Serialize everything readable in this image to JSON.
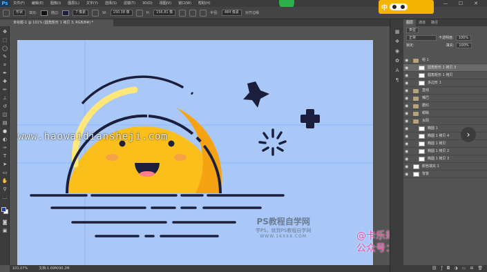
{
  "app": {
    "logo": "Ps"
  },
  "menu": [
    "文件(F)",
    "编辑(E)",
    "图像(I)",
    "图层(L)",
    "文字(Y)",
    "选择(S)",
    "滤镜(T)",
    "3D(D)",
    "视图(V)",
    "窗口(W)",
    "帮助(H)"
  ],
  "options_bar": {
    "mode": "形状",
    "fill_label": "填充:",
    "stroke_label": "描边:",
    "stroke_width": "7 像素",
    "w_label": "W:",
    "w_value": "150.38 像",
    "h_label": "H:",
    "h_value": "156.81 像",
    "radius_label": "半径:",
    "radius_value": "484 像素",
    "align_edges": "对齐边缘"
  },
  "mascot": {
    "text": "中"
  },
  "window_controls": [
    "—",
    "☐",
    "✕"
  ],
  "document_tab": {
    "title": "未标题-1 @ 101% (圆角矩形 1 拷贝 3, RGB/8#) *",
    "close": "×"
  },
  "status_bar": {
    "zoom": "101.07%",
    "doc_info": "文档:1.69M/90.2M"
  },
  "layers_panel": {
    "tabs": [
      "图层",
      "通道",
      "路径"
    ],
    "kind_filter": "类型",
    "blend_mode": "正常",
    "opacity_label": "不透明度:",
    "opacity_value": "100%",
    "lock_label": "锁定:",
    "fill_label": "填充:",
    "fill_value": "100%",
    "layers": [
      {
        "name": "组 1",
        "type": "group",
        "indent": 0,
        "selected": false
      },
      {
        "name": "圆角矩形 1 拷贝 3",
        "type": "layer",
        "indent": 1,
        "selected": true
      },
      {
        "name": "圆角矩形 1 拷贝",
        "type": "layer",
        "indent": 1,
        "selected": false
      },
      {
        "name": "多边形 1",
        "type": "layer",
        "indent": 1,
        "selected": false
      },
      {
        "name": "直线",
        "type": "group",
        "indent": 0,
        "selected": false
      },
      {
        "name": "嘴巴",
        "type": "group",
        "indent": 0,
        "selected": false
      },
      {
        "name": "腮红",
        "type": "group",
        "indent": 0,
        "selected": false
      },
      {
        "name": "眼睛",
        "type": "group",
        "indent": 0,
        "selected": false
      },
      {
        "name": "太阳",
        "type": "group",
        "indent": 0,
        "selected": false
      },
      {
        "name": "椭圆 1",
        "type": "layer",
        "indent": 1,
        "selected": false
      },
      {
        "name": "椭圆 1 拷贝 4",
        "type": "layer",
        "indent": 1,
        "selected": false
      },
      {
        "name": "椭圆 1 拷贝",
        "type": "layer",
        "indent": 1,
        "selected": false
      },
      {
        "name": "椭圆 1 拷贝 2",
        "type": "layer",
        "indent": 1,
        "selected": false
      },
      {
        "name": "椭圆 1 拷贝 3",
        "type": "layer",
        "indent": 1,
        "selected": false
      },
      {
        "name": "颜色填充 1",
        "type": "layer",
        "indent": 0,
        "selected": false
      },
      {
        "name": "背景",
        "type": "layer",
        "indent": 0,
        "selected": false
      }
    ],
    "nav_button": "›"
  },
  "watermarks": {
    "site": "www.haowaidiansheji.com",
    "ps_title": "PS教程自学网",
    "ps_subtitle": "学PS，就到PS教程自学网",
    "ps_url": "WWW.16XX8.COM",
    "author_line1": "@卡乐筠",
    "author_line2": "公众号：卡乐筠"
  },
  "colors": {
    "canvas_bg": "#a9c8f7",
    "sun": "#fbbf1c",
    "sun_shadow": "#f6a313",
    "outline": "#1b1f3b",
    "foreground": "#1f3ebf"
  },
  "icons": {
    "toolbar": [
      "move-icon",
      "marquee-icon",
      "lasso-icon",
      "quick-select-icon",
      "crop-icon",
      "eyedropper-icon",
      "healing-icon",
      "brush-icon",
      "stamp-icon",
      "history-brush-icon",
      "eraser-icon",
      "gradient-icon",
      "blur-icon",
      "dodge-icon",
      "pen-icon",
      "type-icon",
      "path-select-icon",
      "shape-icon",
      "hand-icon",
      "zoom-icon"
    ]
  }
}
